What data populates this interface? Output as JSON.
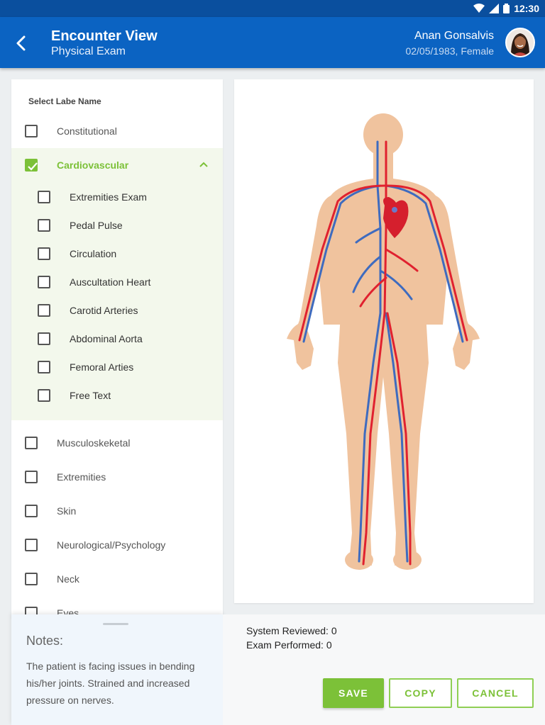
{
  "status_bar": {
    "time": "12:30"
  },
  "header": {
    "title": "Encounter View",
    "subtitle": "Physical Exam",
    "patient_name": "Anan Gonsalvis",
    "patient_meta": "02/05/1983, Female"
  },
  "exam_list": {
    "label": "Select Labe Name",
    "categories": [
      {
        "label": "Constitutional",
        "checked": false
      },
      {
        "label": "Cardiovascular",
        "checked": true,
        "expanded": true
      },
      {
        "label": "Musculoskeketal",
        "checked": false
      },
      {
        "label": "Extremities",
        "checked": false
      },
      {
        "label": "Skin",
        "checked": false
      },
      {
        "label": "Neurological/Psychology",
        "checked": false
      },
      {
        "label": "Neck",
        "checked": false
      },
      {
        "label": "Eyes",
        "checked": false
      }
    ],
    "cardiovascular_items": [
      {
        "label": "Extremities Exam",
        "checked": false
      },
      {
        "label": "Pedal Pulse",
        "checked": false
      },
      {
        "label": "Circulation",
        "checked": false
      },
      {
        "label": "Auscultation Heart",
        "checked": false
      },
      {
        "label": "Carotid Arteries",
        "checked": false
      },
      {
        "label": "Abdominal Aorta",
        "checked": false
      },
      {
        "label": "Femoral Arties",
        "checked": false
      },
      {
        "label": "Free Text",
        "checked": false
      }
    ]
  },
  "notes": {
    "title": "Notes:",
    "body": "The patient is facing issues in bending his/her joints. Strained and increased pressure on nerves."
  },
  "summary": {
    "system_reviewed": "System Reviewed: 0",
    "exam_performed": "Exam Performed: 0"
  },
  "actions": {
    "save": "SAVE",
    "copy": "COPY",
    "cancel": "CANCEL"
  },
  "colors": {
    "primary": "#0b63c2",
    "accent": "#7cc138",
    "artery": "#e0212f",
    "vein": "#3e6bbf",
    "skin": "#f0c39e"
  }
}
